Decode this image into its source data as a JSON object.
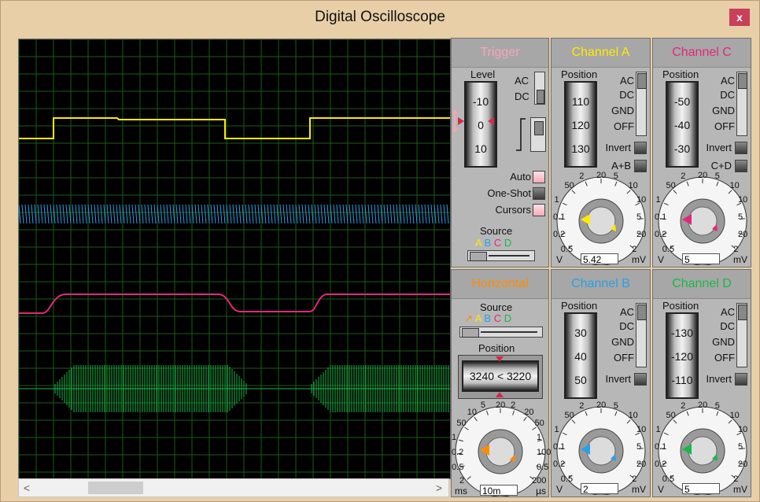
{
  "window": {
    "title": "Digital Oscilloscope",
    "close_label": "x"
  },
  "colors": {
    "channel_a": "#ffea00",
    "channel_b": "#2aa0e6",
    "channel_c": "#e0287c",
    "channel_d": "#18b848",
    "trigger": "#f7a6b8",
    "horizontal": "#ff8c00"
  },
  "trigger": {
    "title": "Trigger",
    "level_label": "Level",
    "ticks": [
      "-10",
      "0",
      "10"
    ],
    "ac": "AC",
    "dc": "DC",
    "auto": "Auto",
    "oneshot": "One-Shot",
    "cursors": "Cursors",
    "source_label": "Source",
    "sources": [
      "A",
      "B",
      "C",
      "D"
    ]
  },
  "channel_a": {
    "title": "Channel A",
    "position_label": "Position",
    "ticks": [
      "110",
      "120",
      "130"
    ],
    "ac": "AC",
    "dc": "DC",
    "gnd": "GND",
    "off": "OFF",
    "invert": "Invert",
    "combine": "A+B",
    "scale": [
      "0.5",
      "0.2",
      "0.1",
      "1",
      "50",
      "2",
      "20",
      "5",
      "10",
      "10",
      "5",
      "20",
      "2"
    ],
    "unit_left": "V",
    "unit_right": "mV",
    "value": "5.42"
  },
  "channel_c": {
    "title": "Channel C",
    "position_label": "Position",
    "ticks": [
      "-50",
      "-40",
      "-30"
    ],
    "ac": "AC",
    "dc": "DC",
    "gnd": "GND",
    "off": "OFF",
    "invert": "Invert",
    "combine": "C+D",
    "scale": [
      "0.5",
      "0.2",
      "0.1",
      "1",
      "50",
      "2",
      "20",
      "5",
      "10",
      "10",
      "5",
      "20",
      "2"
    ],
    "unit_left": "V",
    "unit_right": "mV",
    "value": "5"
  },
  "horizontal": {
    "title": "Horizontal",
    "source_label": "Source",
    "sources": [
      "A",
      "B",
      "C",
      "D"
    ],
    "position_label": "Position",
    "position_value": "3240 < 3220",
    "scale": [
      "2",
      "0.5",
      "0.2",
      "1",
      "50",
      "10",
      "5",
      "20",
      "2",
      "20",
      "50",
      "1",
      "100",
      "0.5",
      "200"
    ],
    "unit_left": "ms",
    "unit_right": "µs",
    "value": "10m"
  },
  "channel_b": {
    "title": "Channel B",
    "position_label": "Position",
    "ticks": [
      "30",
      "40",
      "50"
    ],
    "ac": "AC",
    "dc": "DC",
    "gnd": "GND",
    "off": "OFF",
    "invert": "Invert",
    "scale": [
      "0.5",
      "0.2",
      "0.1",
      "1",
      "50",
      "2",
      "20",
      "5",
      "10",
      "10",
      "5",
      "20",
      "2"
    ],
    "unit_left": "V",
    "unit_right": "mV",
    "value": "2"
  },
  "channel_d": {
    "title": "Channel D",
    "position_label": "Position",
    "ticks": [
      "-130",
      "-120",
      "-110"
    ],
    "ac": "AC",
    "dc": "DC",
    "gnd": "GND",
    "off": "OFF",
    "invert": "Invert",
    "scale": [
      "0.5",
      "0.2",
      "0.1",
      "1",
      "50",
      "2",
      "20",
      "5",
      "10",
      "10",
      "5",
      "20",
      "2"
    ],
    "unit_left": "V",
    "unit_right": "mV",
    "value": "5"
  },
  "scrollbar": {
    "left_arrow": "<",
    "right_arrow": ">"
  }
}
